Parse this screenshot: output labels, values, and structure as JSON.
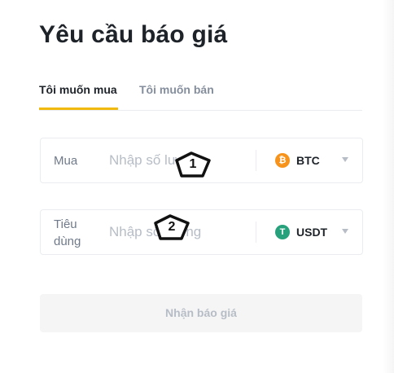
{
  "page": {
    "title": "Yêu cầu báo giá"
  },
  "tabs": [
    {
      "label": "Tôi muốn mua",
      "active": true
    },
    {
      "label": "Tôi muốn bán",
      "active": false
    }
  ],
  "buy_field": {
    "label": "Mua",
    "placeholder": "Nhập số lượng",
    "coin": {
      "symbol": "BTC",
      "icon": "bitcoin-icon",
      "icon_glyph": "₿",
      "color": "#f7931a"
    }
  },
  "spend_field": {
    "label": "Tiêu dùng",
    "placeholder": "Nhập số lượng",
    "coin": {
      "symbol": "USDT",
      "icon": "tether-icon",
      "icon_glyph": "T",
      "color": "#26a17b"
    }
  },
  "quote_button": {
    "label": "Nhận báo giá",
    "enabled": false
  },
  "markers": [
    {
      "label": "1"
    },
    {
      "label": "2"
    }
  ],
  "colors": {
    "accent": "#f0b90b",
    "text_primary": "#1e2329",
    "text_secondary": "#848e9c",
    "placeholder": "#b7bdc6",
    "border": "#eaecef"
  }
}
